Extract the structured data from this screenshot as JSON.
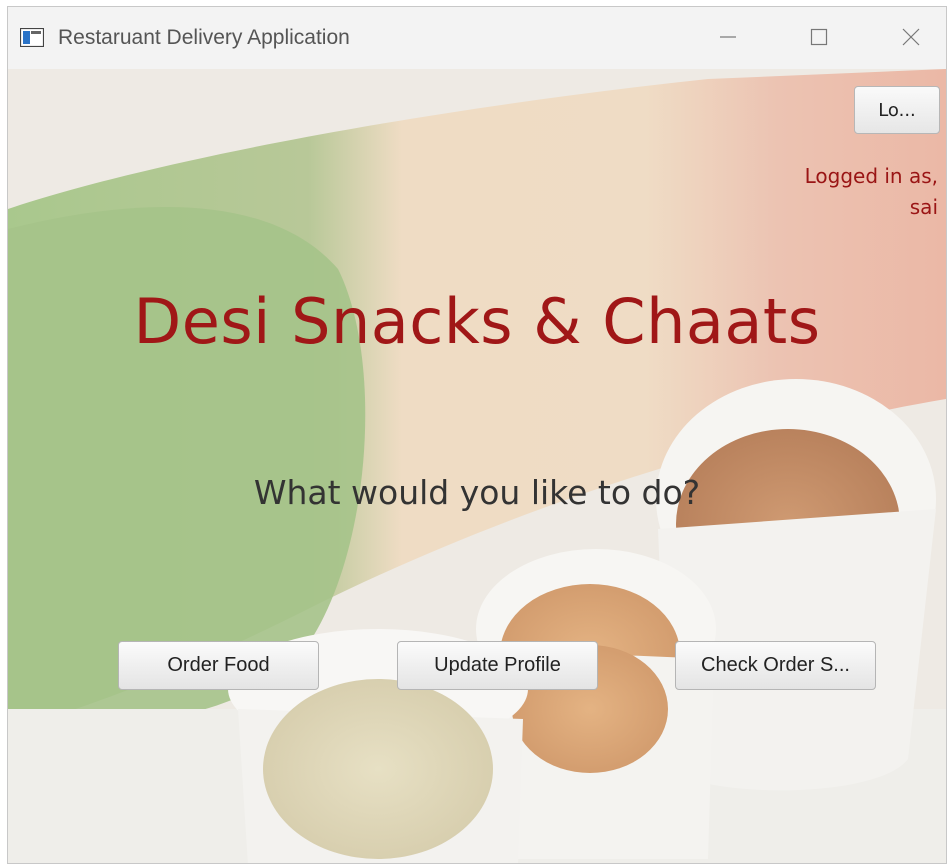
{
  "window": {
    "title": "Restaruant Delivery Application",
    "icons": {
      "app": "app-window-icon",
      "minimize": "minimize-icon",
      "maximize": "maximize-icon",
      "close": "close-icon"
    }
  },
  "header": {
    "logout_label": "Lo...",
    "logged_in_label": "Logged in as,",
    "username": "sai"
  },
  "main": {
    "restaurant_name": "Desi Snacks & Chaats",
    "prompt": "What would you like to do?",
    "actions": [
      {
        "label": "Order Food"
      },
      {
        "label": "Update Profile"
      },
      {
        "label": "Check Order S..."
      }
    ]
  },
  "colors": {
    "accent_red": "#a01717",
    "prompt_text": "#333333",
    "window_bg": "#f3f3f3"
  }
}
